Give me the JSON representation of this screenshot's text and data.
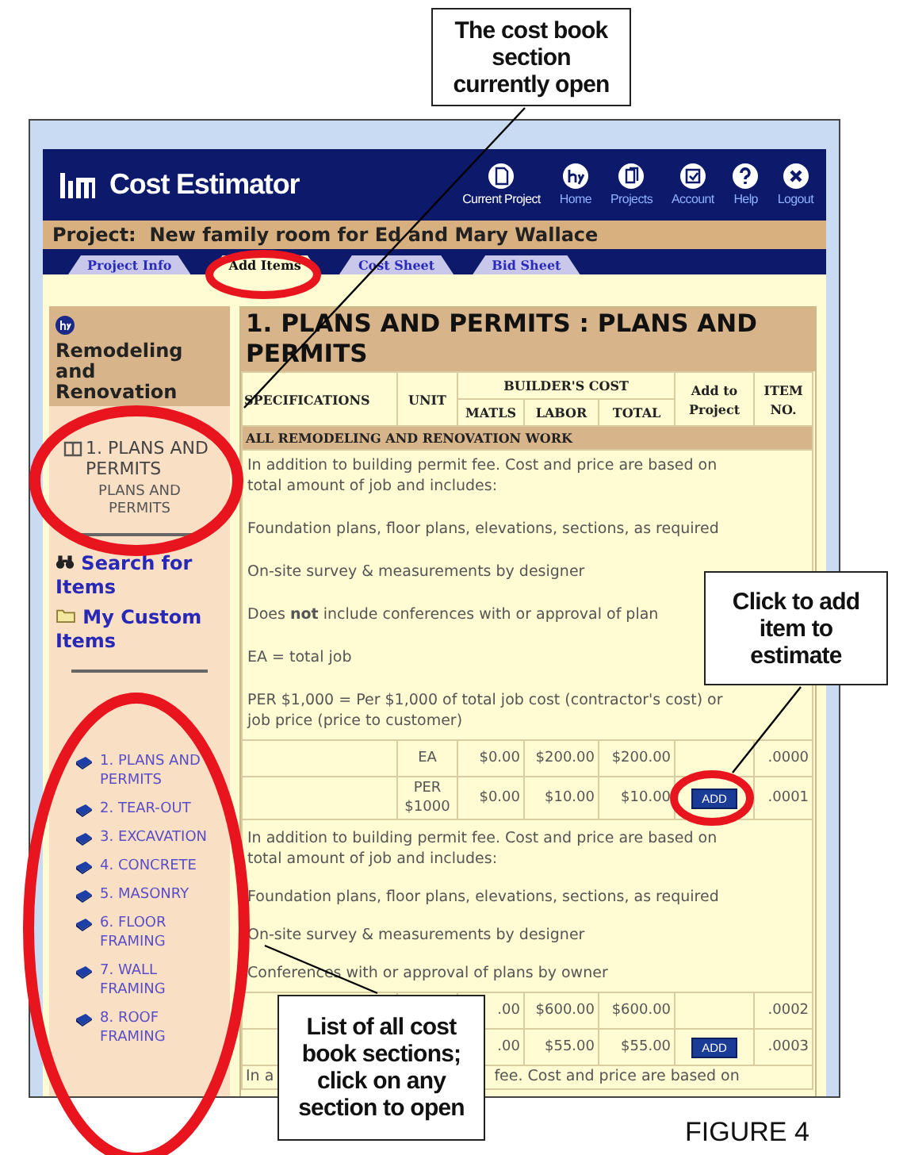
{
  "callouts": [
    {
      "text": "The cost book section currently open"
    },
    {
      "text": "Click to add item to estimate"
    },
    {
      "text": "List of all cost book sections; click on any section to open"
    }
  ],
  "figure_caption": "FIGURE 4",
  "app": {
    "title": "Cost Estimator",
    "nav": [
      {
        "label": "Current Project",
        "selected": true
      },
      {
        "label": "Home",
        "selected": false
      },
      {
        "label": "Projects",
        "selected": false
      },
      {
        "label": "Account",
        "selected": false
      },
      {
        "label": "Help",
        "selected": false
      },
      {
        "label": "Logout",
        "selected": false
      }
    ],
    "project": "Project:  New family room for Ed and Mary Wallace",
    "tabs": [
      {
        "label": "Project Info",
        "selected": false
      },
      {
        "label": "Add Items",
        "selected": true
      },
      {
        "label": "Cost Sheet",
        "selected": false
      },
      {
        "label": "Bid Sheet",
        "selected": false
      }
    ],
    "sidebar": {
      "book": "Remodeling and Renovation",
      "current_section": "1. PLANS AND PERMITS",
      "current_subsection": "PLANS AND PERMITS",
      "links": [
        "Search for Items",
        "My Custom Items"
      ],
      "sections": [
        "1. PLANS AND PERMITS",
        "2. TEAR-OUT",
        "3. EXCAVATION",
        "4. CONCRETE",
        "5. MASONRY",
        "6. FLOOR FRAMING",
        "7. WALL FRAMING",
        "8. ROOF FRAMING"
      ]
    },
    "content": {
      "title": "1. PLANS AND PERMITS : PLANS AND PERMITS",
      "columns": {
        "specifications": "SPECIFICATIONS",
        "unit": "UNIT",
        "builders_cost": "BUILDER'S COST",
        "matls": "MATLS",
        "labor": "LABOR",
        "total": "TOTAL",
        "add": "Add to Project",
        "item_no": "ITEM NO."
      },
      "group": "ALL REMODELING AND RENOVATION WORK",
      "blocks": [
        {
          "paragraphs": [
            "In addition to building permit fee. Cost and price are based on total amount of job and includes:",
            "Foundation plans, floor plans, elevations, sections, as required",
            "On-site survey & measurements by designer",
            "Does **not** include conferences with or approval of plan",
            "EA = total job",
            "PER $1,000 = Per $1,000 of total job cost (contractor's cost) or job price (price to customer)"
          ],
          "rows": [
            {
              "unit": "EA",
              "matls": "$0.00",
              "labor": "$200.00",
              "total": "$200.00",
              "item_no": ".0000"
            },
            {
              "unit": "PER $1000",
              "matls": "$0.00",
              "labor": "$10.00",
              "total": "$10.00",
              "add_button": "ADD",
              "item_no": ".0001"
            }
          ]
        },
        {
          "paragraphs": [
            "In addition to building permit fee. Cost and price are based on total amount of job and includes:",
            "Foundation plans, floor plans, elevations, sections, as required",
            "On-site survey & measurements by designer",
            "Conferences with or approval of plans by owner"
          ],
          "rows": [
            {
              "matls": ".00",
              "labor": "$600.00",
              "total": "$600.00",
              "item_no": ".0002"
            },
            {
              "matls": ".00",
              "labor": "$55.00",
              "total": "$55.00",
              "add_button": "ADD",
              "item_no": ".0003"
            }
          ]
        }
      ],
      "last_line": {
        "left": "In a",
        "right": "fee. Cost and price are based on"
      }
    }
  }
}
